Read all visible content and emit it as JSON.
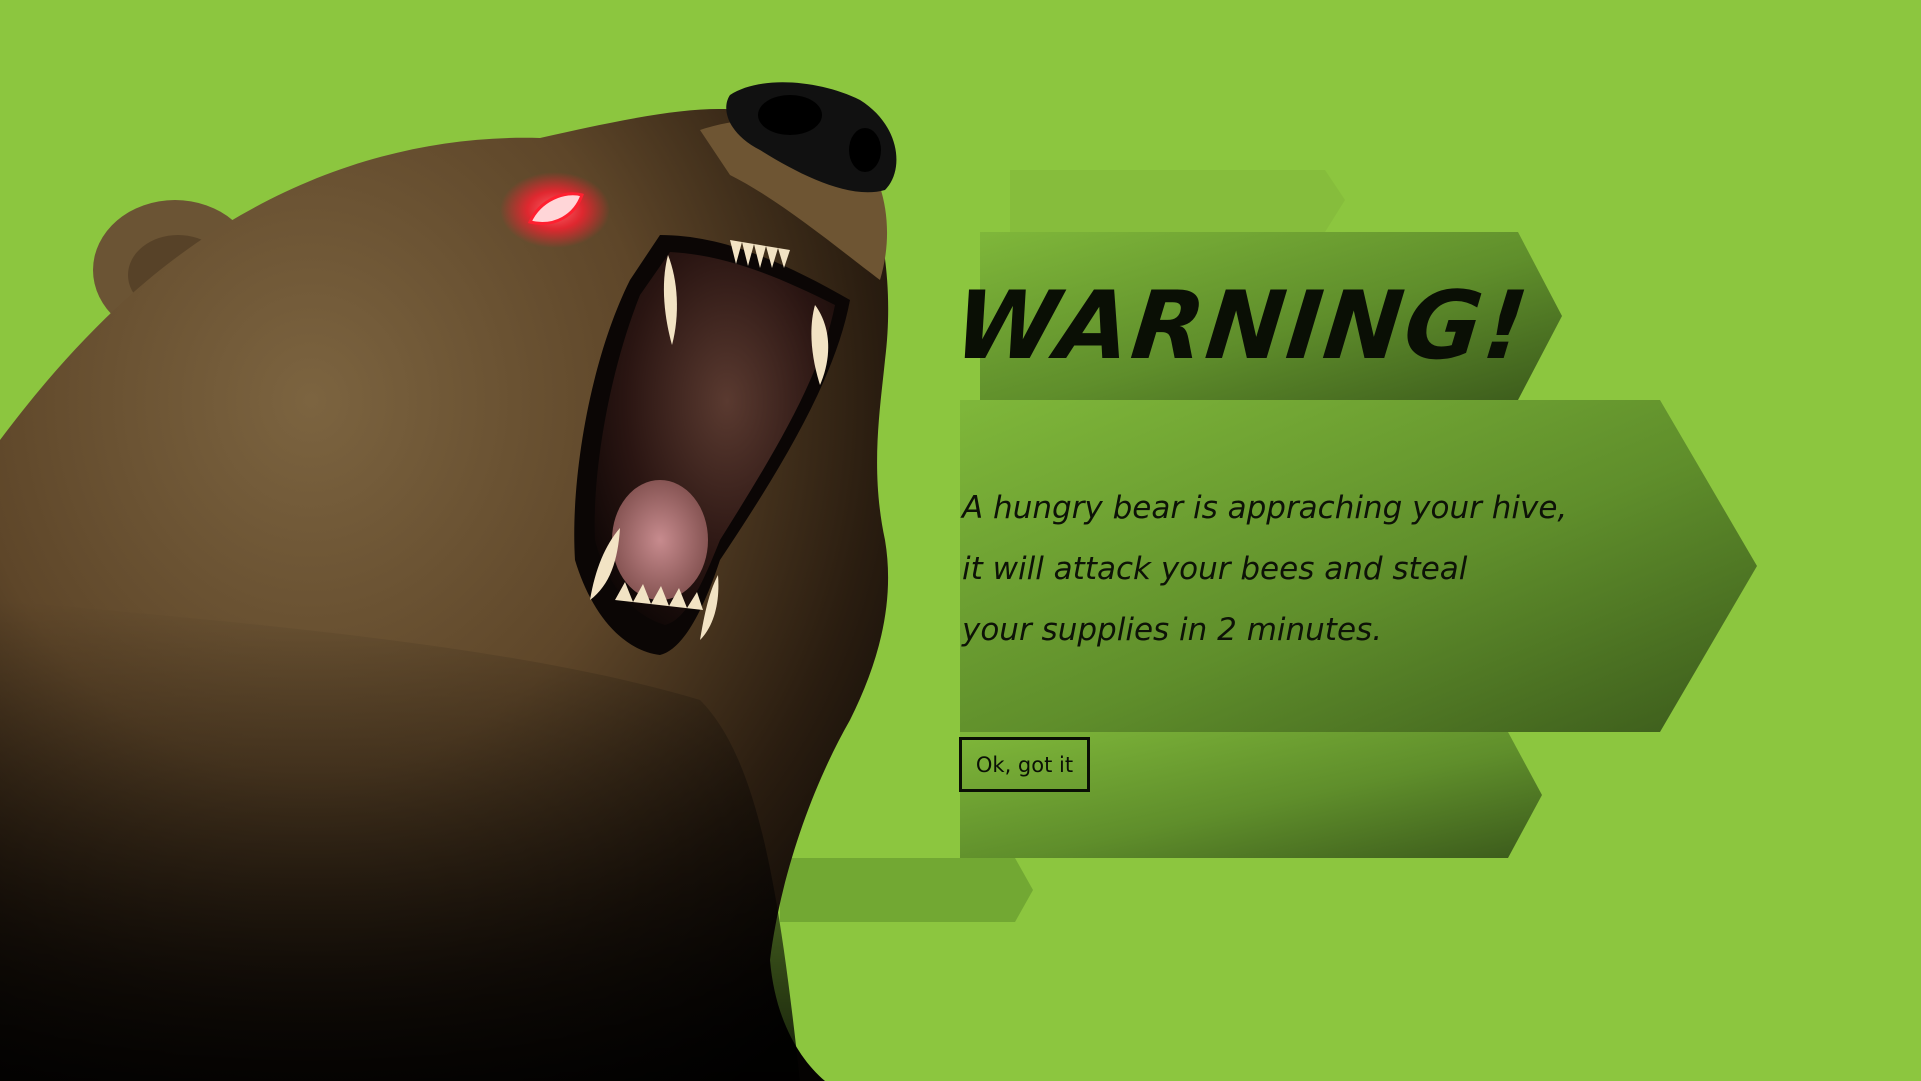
{
  "dialog": {
    "title": "WARNING!",
    "message_lines": [
      "A hungry bear is appraching your hive,",
      "it will attack your bees and steal",
      "your supplies in 2 minutes."
    ],
    "ok_label": "Ok, got it"
  },
  "colors": {
    "background": "#8cc63f",
    "panel_light": "#7cb236",
    "panel_dark": "#3f5f1e",
    "bear_fur": "#6b5232",
    "bear_shadow": "#0b0805",
    "eye_glow": "#ff3040",
    "text": "#0a0f05"
  },
  "illustration": {
    "subject": "bear-roaring",
    "eye_state": "glowing-red"
  }
}
